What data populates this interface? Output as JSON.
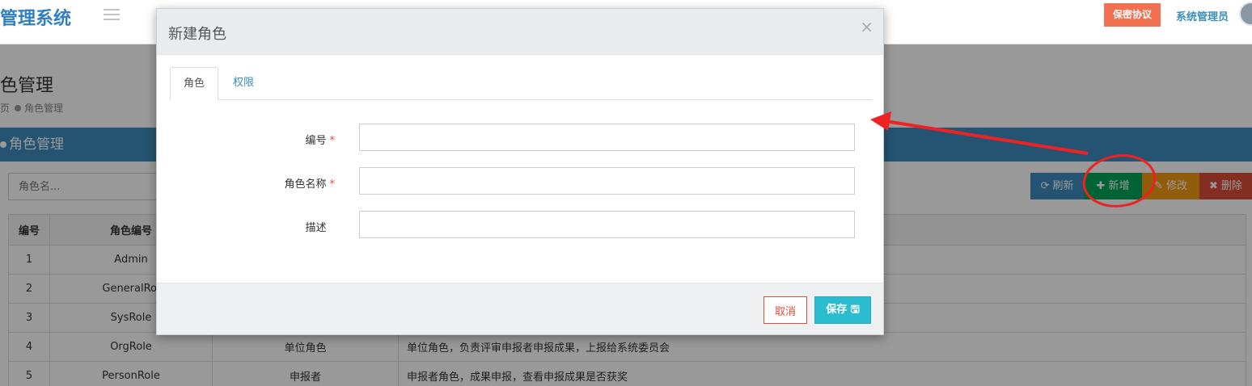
{
  "app": {
    "brand": "管理系统"
  },
  "header": {
    "secret_btn": "保密协议",
    "user_name": "系统管理员"
  },
  "page": {
    "title": "色管理",
    "breadcrumb": {
      "home": "页",
      "current": "角色管理"
    },
    "box_title": "角色管理"
  },
  "toolbar": {
    "search_placeholder": "角色名...",
    "refresh": "刷新",
    "add": "新增",
    "edit": "修改",
    "delete": "删除"
  },
  "table": {
    "headers": [
      "编号",
      "角色编号",
      "",
      ""
    ],
    "rows": [
      {
        "id": "1",
        "code": "Admin",
        "name": "",
        "desc": ""
      },
      {
        "id": "2",
        "code": "GeneralRol",
        "name": "",
        "desc": ""
      },
      {
        "id": "3",
        "code": "SysRole",
        "name": "",
        "desc": ""
      },
      {
        "id": "4",
        "code": "OrgRole",
        "name": "单位角色",
        "desc": "单位角色，负责评审申报者申报成果，上报给系统委员会"
      },
      {
        "id": "5",
        "code": "PersonRole",
        "name": "申报者",
        "desc": "申报者角色，成果申报，查看申报成果是否获奖"
      }
    ]
  },
  "modal": {
    "title": "新建角色",
    "close": "×",
    "tabs": [
      "角色",
      "权限"
    ],
    "fields": {
      "code_label": "编号",
      "name_label": "角色名称",
      "desc_label": "描述",
      "required_mark": "*",
      "code_value": "",
      "name_value": "",
      "desc_value": ""
    },
    "cancel": "取消",
    "save": "保存"
  },
  "colors": {
    "primary": "#3c8dbc",
    "success": "#00a65a",
    "warning": "#f39c12",
    "danger": "#dd4b39",
    "save": "#2bbcd0",
    "annotation": "#ee2222"
  },
  "icons": {
    "refresh": "refresh-icon",
    "add": "plus-icon",
    "edit": "edit-icon",
    "delete": "times-icon",
    "save": "floppy-icon",
    "menu": "hamburger-icon"
  }
}
